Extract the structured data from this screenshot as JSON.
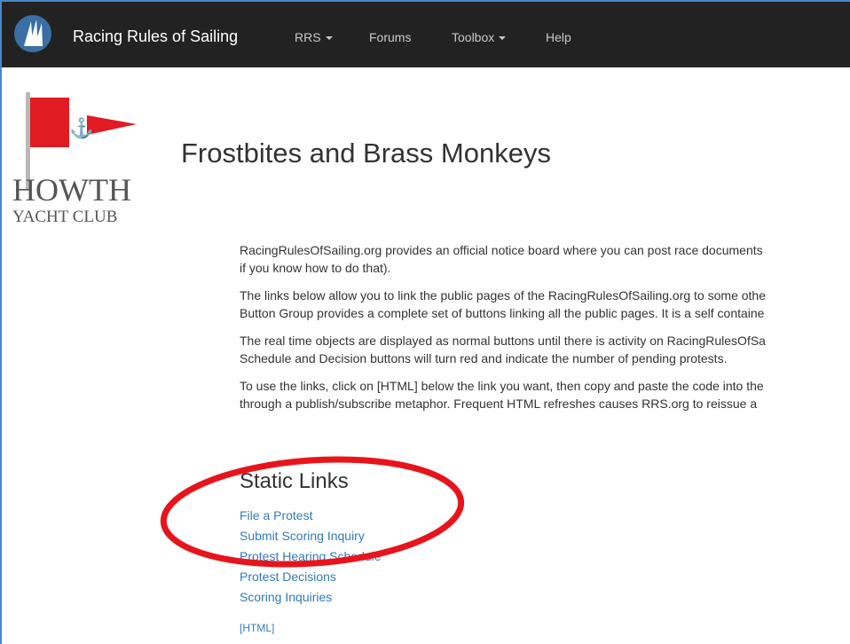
{
  "navbar": {
    "brand_title": "Racing Rules of Sailing",
    "items": [
      {
        "label": "RRS",
        "dropdown": true
      },
      {
        "label": "Forums",
        "dropdown": false
      },
      {
        "label": "Toolbox",
        "dropdown": true
      },
      {
        "label": "Help",
        "dropdown": false
      }
    ]
  },
  "club_logo": {
    "name_line1": "HOWTH",
    "name_line2": "YACHT CLUB",
    "flag_color": "#e01b22"
  },
  "page": {
    "title": "Frostbites and Brass Monkeys",
    "paragraphs": [
      {
        "line1": "RacingRulesOfSailing.org provides an official notice board where you can post race documents",
        "line2": "if you know how to do that)."
      },
      {
        "line1": "The links below allow you to link the public pages of the RacingRulesOfSailing.org to some othe",
        "line2": "Button Group provides a complete set of buttons linking all the public pages. It is a self containe"
      },
      {
        "line1": "The real time objects are displayed as normal buttons until there is activity on RacingRulesOfSa",
        "line2": "Schedule and Decision buttons will turn red and indicate the number of pending protests."
      },
      {
        "line1": "To use the links, click on [HTML] below the link you want, then copy and paste the code into the",
        "line2": "through a publish/subscribe metaphor. Frequent HTML refreshes causes RRS.org to reissue a"
      }
    ],
    "static_links": {
      "heading": "Static Links",
      "links": [
        "File a Protest",
        "Submit Scoring Inquiry",
        "Protest Hearing Schedule",
        "Protest Decisions",
        "Scoring Inquiries"
      ],
      "html_label": "[HTML]"
    }
  },
  "colors": {
    "navbar_bg": "#222222",
    "link": "#337ab7",
    "highlight_ellipse": "#e8141b"
  }
}
